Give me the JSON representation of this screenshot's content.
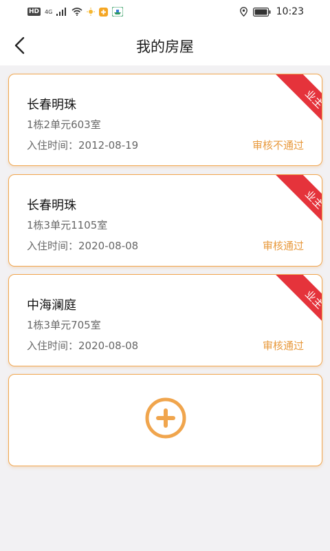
{
  "status_bar": {
    "left_badge": "HD",
    "network": "4G",
    "time": "10:23"
  },
  "header": {
    "title": "我的房屋",
    "back_icon": "chevron-left-icon"
  },
  "houses": [
    {
      "name": "长春明珠",
      "unit": "1栋2单元603室",
      "move_in_label": "入住时间：",
      "move_in_date": "2012-08-19",
      "status": "审核不通过",
      "role": "业主"
    },
    {
      "name": "长春明珠",
      "unit": "1栋3单元1105室",
      "move_in_label": "入住时间：",
      "move_in_date": "2020-08-08",
      "status": "审核通过",
      "role": "业主"
    },
    {
      "name": "中海澜庭",
      "unit": "1栋3单元705室",
      "move_in_label": "入住时间：",
      "move_in_date": "2020-08-08",
      "status": "审核通过",
      "role": "业主"
    }
  ],
  "add_card": {
    "icon": "plus-circle-icon"
  },
  "colors": {
    "accent": "#f0a54d",
    "status_text": "#e8993c",
    "ribbon": "#e5333b",
    "background": "#f2f1f3"
  }
}
